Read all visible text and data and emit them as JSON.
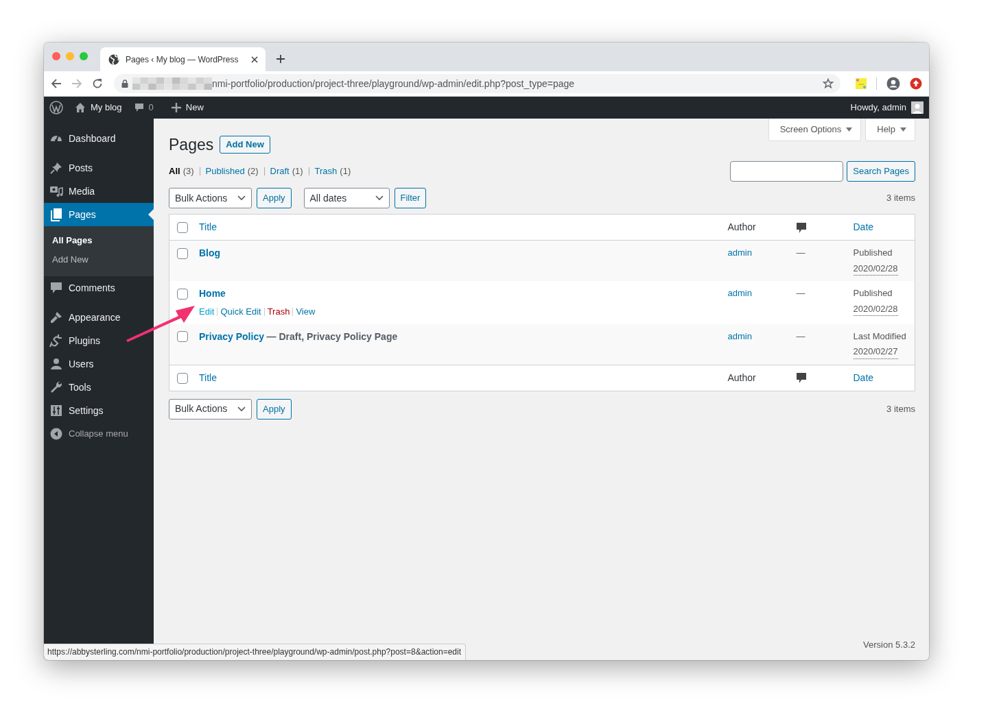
{
  "browser": {
    "tab_title": "Pages ‹ My blog — WordPress",
    "address": "nmi-portfolio/production/project-three/playground/wp-admin/edit.php?post_type=page",
    "status_url": "https://abbysterling.com/nmi-portfolio/production/project-three/playground/wp-admin/post.php?post=8&action=edit"
  },
  "admin_bar": {
    "site": "My blog",
    "comments_count": "0",
    "new": "New",
    "greeting": "Howdy, admin"
  },
  "sidebar": {
    "groups": [
      [
        {
          "label": "Dashboard",
          "selected": false
        }
      ],
      [
        {
          "label": "Posts",
          "selected": false
        },
        {
          "label": "Media",
          "selected": false
        },
        {
          "label": "Pages",
          "selected": true,
          "children": [
            {
              "label": "All Pages",
              "selected": true
            },
            {
              "label": "Add New",
              "selected": false
            }
          ]
        },
        {
          "label": "Comments",
          "selected": false
        }
      ],
      [
        {
          "label": "Appearance",
          "selected": false
        },
        {
          "label": "Plugins",
          "selected": false
        },
        {
          "label": "Users",
          "selected": false
        },
        {
          "label": "Tools",
          "selected": false
        },
        {
          "label": "Settings",
          "selected": false
        }
      ]
    ],
    "collapse": "Collapse menu"
  },
  "screen_tabs": [
    "Screen Options",
    "Help"
  ],
  "heading": {
    "title": "Pages",
    "add_new": "Add New"
  },
  "views": [
    {
      "label": "All",
      "count": "(3)",
      "selected": true
    },
    {
      "label": "Published",
      "count": "(2)",
      "selected": false
    },
    {
      "label": "Draft",
      "count": "(1)",
      "selected": false
    },
    {
      "label": "Trash",
      "count": "(1)",
      "selected": false
    }
  ],
  "search": {
    "button": "Search Pages"
  },
  "tablenav_top": {
    "bulk_actions": "Bulk Actions",
    "apply": "Apply",
    "date_filter": "All dates",
    "filter": "Filter",
    "count": "3 items"
  },
  "table": {
    "header_checked": false,
    "footer_checked": false,
    "columns": [
      {
        "kind": "link",
        "label": "Title"
      },
      {
        "kind": "text",
        "label": "Author"
      },
      {
        "kind": "comments"
      },
      {
        "kind": "link",
        "label": "Date"
      }
    ],
    "rows": [
      {
        "checked": false,
        "title": "Blog",
        "author": "admin",
        "comments": "—",
        "date_status": "Published",
        "date": "2020/02/28"
      },
      {
        "checked": false,
        "title": "Home",
        "author": "admin",
        "comments": "—",
        "date_status": "Published",
        "date": "2020/02/28",
        "row_actions": [
          {
            "label": "Edit",
            "kind": "link",
            "hovered": true
          },
          {
            "label": "Quick Edit",
            "kind": "link",
            "hovered": false
          },
          {
            "label": "Trash",
            "kind": "delete",
            "hovered": false
          },
          {
            "label": "View",
            "kind": "link",
            "hovered": false
          }
        ]
      },
      {
        "checked": false,
        "title": "Privacy Policy",
        "post_state": "— Draft, Privacy Policy Page",
        "author": "admin",
        "comments": "—",
        "date_status": "Last Modified",
        "date": "2020/02/27"
      }
    ],
    "footer_columns": [
      {
        "kind": "link",
        "label": "Title"
      },
      {
        "kind": "text",
        "label": "Author"
      },
      {
        "kind": "comments"
      },
      {
        "kind": "link",
        "label": "Date"
      }
    ]
  },
  "tablenav_bottom": {
    "bulk_actions": "Bulk Actions",
    "apply": "Apply",
    "count": "3 items"
  },
  "footer": {
    "version": "Version 5.3.2"
  }
}
